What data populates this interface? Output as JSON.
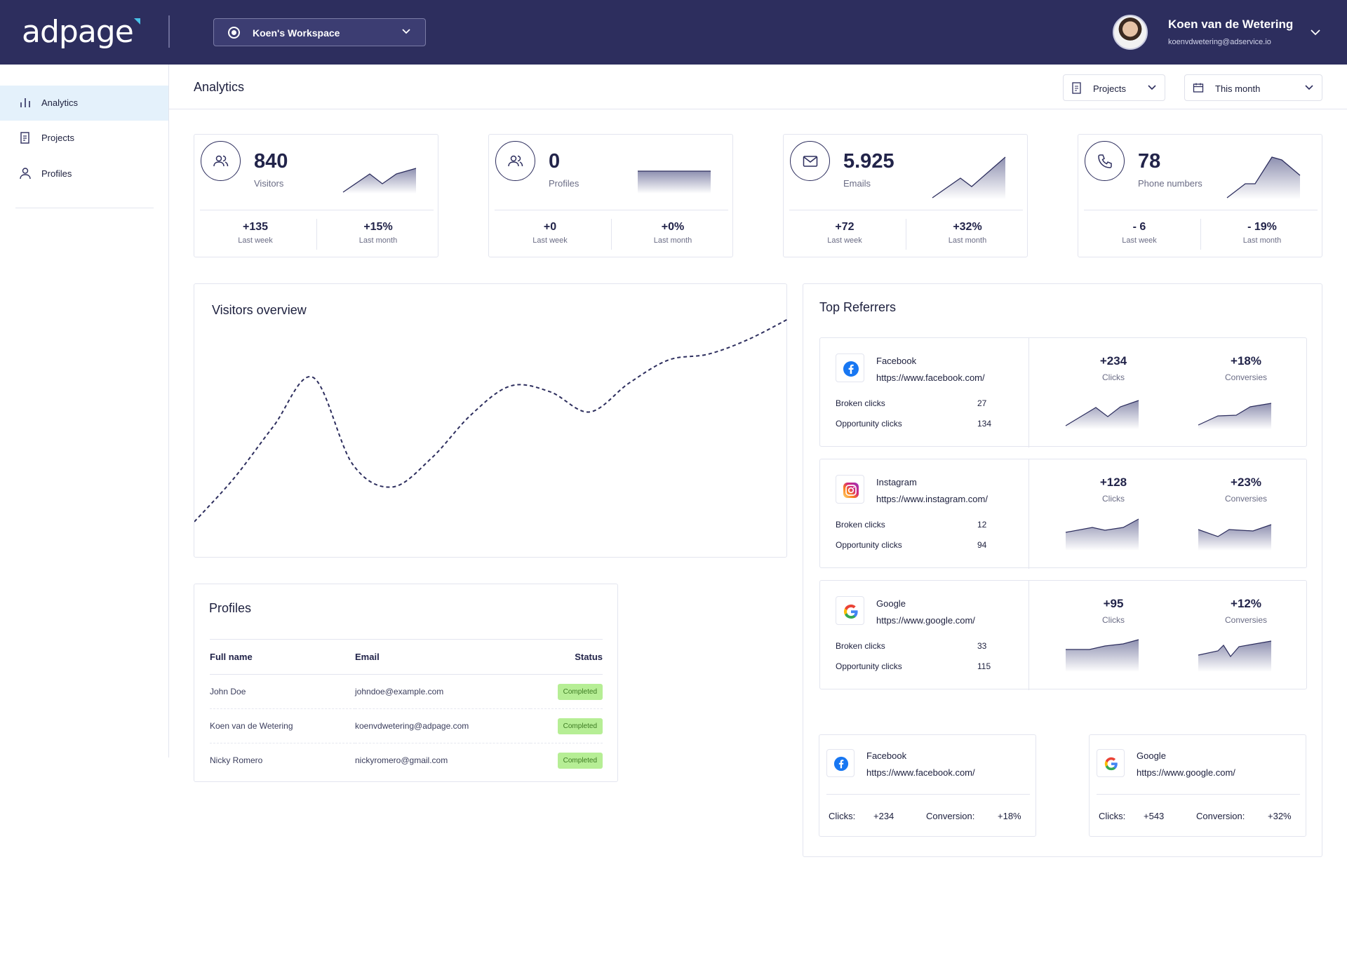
{
  "app": {
    "logo": "adpage"
  },
  "header": {
    "workspace": "Koen's Workspace",
    "user_name": "Koen van de Wetering",
    "user_email": "koenvdwetering@adservice.io"
  },
  "sidebar": {
    "items": [
      {
        "label": "Analytics",
        "icon": "bar-chart-icon"
      },
      {
        "label": "Projects",
        "icon": "document-icon"
      },
      {
        "label": "Profiles",
        "icon": "user-icon"
      }
    ]
  },
  "page": {
    "title": "Analytics",
    "projects_filter": "Projects",
    "date_filter": "This month"
  },
  "stats": [
    {
      "value": "840",
      "label": "Visitors",
      "week": "+135",
      "week_label": "Last week",
      "month": "+15%",
      "month_label": "Last month",
      "icon": "users-icon"
    },
    {
      "value": "0",
      "label": "Profiles",
      "week": "+0",
      "week_label": "Last week",
      "month": "+0%",
      "month_label": "Last month",
      "icon": "users-icon"
    },
    {
      "value": "5.925",
      "label": "Emails",
      "week": "+72",
      "week_label": "Last week",
      "month": "+32%",
      "month_label": "Last month",
      "icon": "mail-icon"
    },
    {
      "value": "78",
      "label": "Phone numbers",
      "week": "- 6",
      "week_label": "Last week",
      "month": "- 19%",
      "month_label": "Last month",
      "icon": "phone-icon"
    }
  ],
  "visitors_overview": {
    "title": "Visitors overview"
  },
  "chart_data": {
    "type": "line",
    "title": "Visitors overview",
    "x": [
      0,
      1,
      2,
      3,
      4,
      5,
      6,
      7,
      8,
      9,
      10,
      11,
      12,
      13,
      14,
      15
    ],
    "values": [
      10,
      25,
      43,
      60,
      30,
      22,
      32,
      47,
      57,
      55,
      48,
      58,
      66,
      68,
      73,
      80
    ],
    "line_style": "dashed",
    "grid": false,
    "ylim": [
      0,
      85
    ]
  },
  "profiles": {
    "title": "Profiles",
    "columns": [
      "Full name",
      "Email",
      "Status"
    ],
    "rows": [
      {
        "name": "John Doe",
        "email": "johndoe@example.com",
        "status": "Completed"
      },
      {
        "name": "Koen van de Wetering",
        "email": "koenvdwetering@adpage.com",
        "status": "Completed"
      },
      {
        "name": "Nicky Romero",
        "email": "nickyromero@gmail.com",
        "status": "Completed"
      }
    ]
  },
  "referrers": {
    "title": "Top Referrers",
    "broken_label": "Broken clicks",
    "opportunity_label": "Opportunity clicks",
    "clicks_label": "Clicks",
    "conv_label": "Conversies",
    "items": [
      {
        "name": "Facebook",
        "url": "https://www.facebook.com/",
        "broken": "27",
        "opportunity": "134",
        "clicks": "+234",
        "conversions": "+18%",
        "icon": "facebook-icon"
      },
      {
        "name": "Instagram",
        "url": "https://www.instagram.com/",
        "broken": "12",
        "opportunity": "94",
        "clicks": "+128",
        "conversions": "+23%",
        "icon": "instagram-icon"
      },
      {
        "name": "Google",
        "url": "https://www.google.com/",
        "broken": "33",
        "opportunity": "115",
        "clicks": "+95",
        "conversions": "+12%",
        "icon": "google-icon"
      }
    ]
  },
  "mini_cards": {
    "clicks_label": "Clicks:",
    "conversion_label": "Conversion:",
    "items": [
      {
        "name": "Facebook",
        "url": "https://www.facebook.com/",
        "clicks": "+234",
        "conversion": "+18%",
        "icon": "facebook-icon"
      },
      {
        "name": "Google",
        "url": "https://www.google.com/",
        "clicks": "+543",
        "conversion": "+32%",
        "icon": "google-icon"
      }
    ]
  }
}
